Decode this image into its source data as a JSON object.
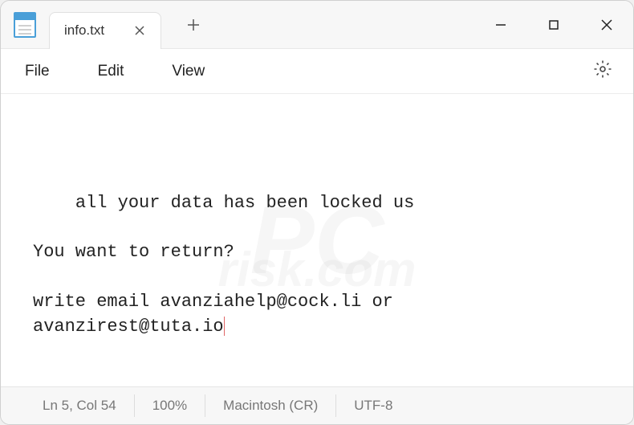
{
  "titlebar": {
    "tab_title": "info.txt"
  },
  "menubar": {
    "file": "File",
    "edit": "Edit",
    "view": "View"
  },
  "content": {
    "line1": "all your data has been locked us",
    "line2": "You want to return?",
    "line3a": "write email avanziahelp@cock.li or",
    "line3b": "avanzirest@tuta.io"
  },
  "statusbar": {
    "position": "Ln 5, Col 54",
    "zoom": "100%",
    "line_ending": "Macintosh (CR)",
    "encoding": "UTF-8"
  },
  "watermark": {
    "main": "PC",
    "sub": "risk.com"
  }
}
